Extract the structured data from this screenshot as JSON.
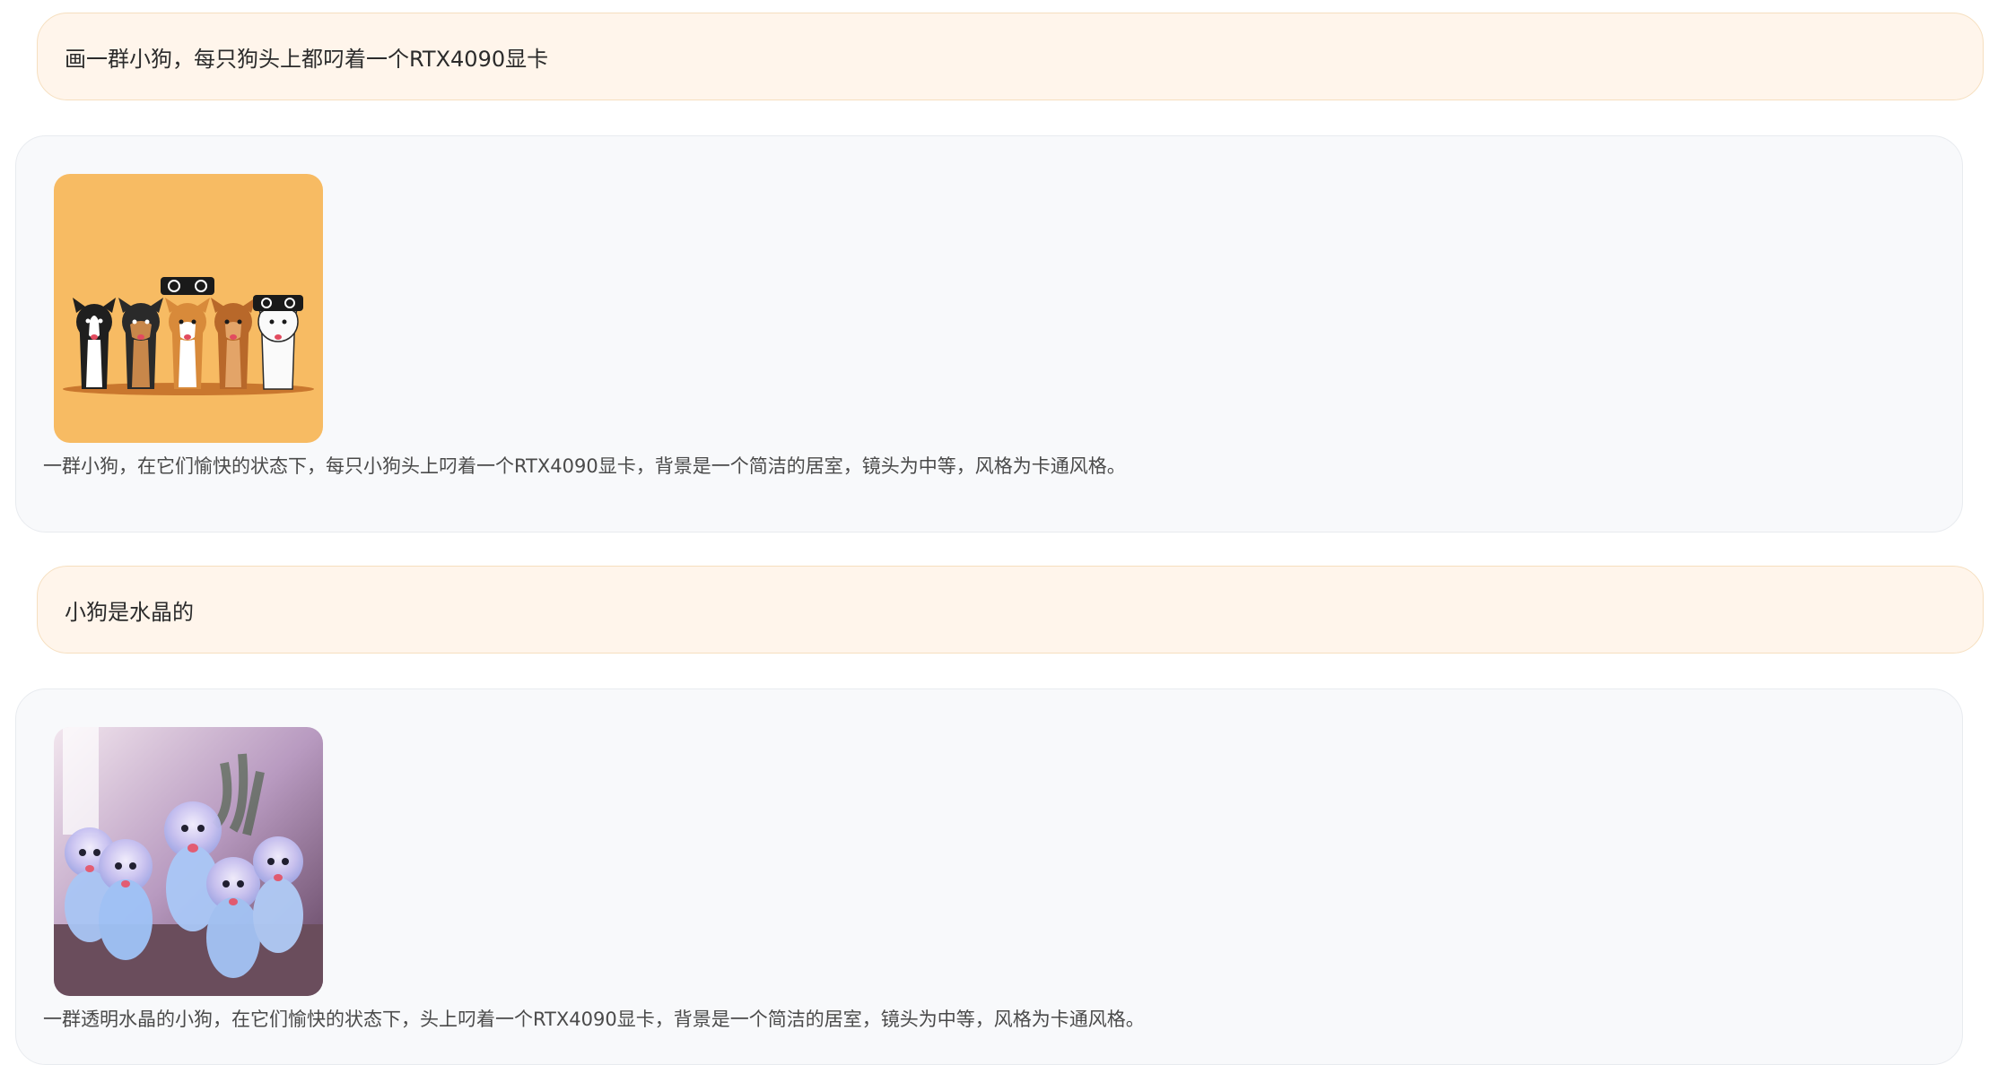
{
  "conversation": {
    "messages": [
      {
        "role": "user",
        "text": "画一群小狗，每只狗头上都叼着一个RTX4090显卡"
      },
      {
        "role": "assistant",
        "image_icon": "cartoon-puppies-image",
        "caption": "一群小狗，在它们愉快的状态下，每只小狗头上叼着一个RTX4090显卡，背景是一个简洁的居室，镜头为中等，风格为卡通风格。"
      },
      {
        "role": "user",
        "text": "小狗是水晶的"
      },
      {
        "role": "assistant",
        "image_icon": "crystal-puppies-image",
        "caption": "一群透明水晶的小狗，在它们愉快的状态下，头上叼着一个RTX4090显卡，背景是一个简洁的居室，镜头为中等，风格为卡通风格。"
      }
    ]
  },
  "colors": {
    "user_bubble_bg": "#fff5eb",
    "user_bubble_border": "#f6dfbf",
    "assistant_card_bg": "#f8f9fb",
    "assistant_card_border": "#e8ebef",
    "image1_bg": "#f7bb63"
  }
}
